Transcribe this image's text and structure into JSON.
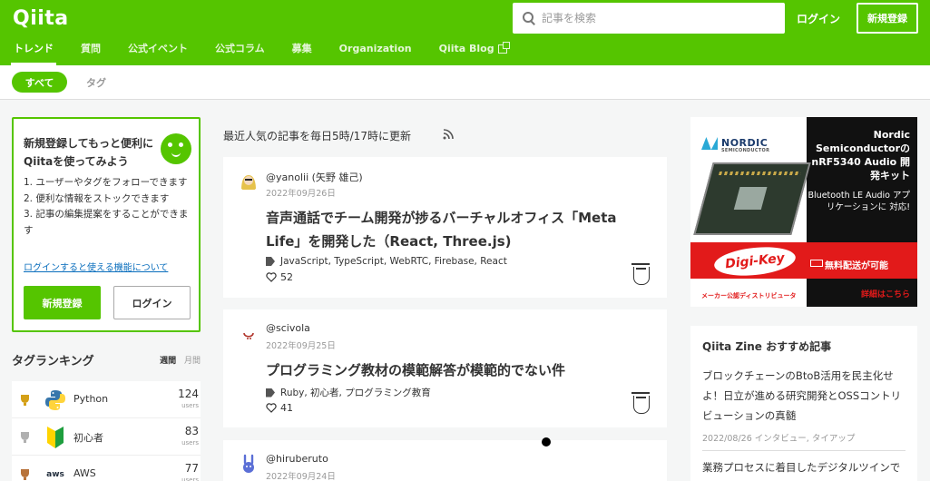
{
  "header": {
    "logo": "Qiita",
    "search_placeholder": "記事を検索",
    "login": "ログイン",
    "signup": "新規登録",
    "nav": [
      {
        "label": "トレンド",
        "active": true
      },
      {
        "label": "質問"
      },
      {
        "label": "公式イベント"
      },
      {
        "label": "公式コラム"
      },
      {
        "label": "募集"
      },
      {
        "label": "Organization"
      },
      {
        "label": "Qiita Blog",
        "external": true
      }
    ]
  },
  "subnav": {
    "all": "すべて",
    "tag": "タグ"
  },
  "signup_card": {
    "title": "新規登録してもっと便利にQiitaを使ってみよう",
    "items": [
      "1. ユーザーやタグをフォローできます",
      "2. 便利な情報をストックできます",
      "3. 記事の編集提案をすることができます"
    ],
    "features_link": "ログインすると使える機能について",
    "signup": "新規登録",
    "login": "ログイン"
  },
  "ranking": {
    "title": "タグランキング",
    "weekly": "週間",
    "monthly": "月間",
    "unit": "users",
    "rows": [
      {
        "name": "Python",
        "count": "124",
        "trophy_color": "#d4a017"
      },
      {
        "name": "初心者",
        "count": "83",
        "trophy_color": "#b0b0b0"
      },
      {
        "name": "AWS",
        "count": "77",
        "trophy_color": "#b8733a"
      }
    ]
  },
  "feed": {
    "update_note": "最近人気の記事を毎日5時/17時に更新",
    "articles": [
      {
        "author": "@yanolii (矢野 雄己)",
        "date": "2022年09月26日",
        "title": "音声通話でチーム開発が捗るバーチャルオフィス「Meta Life」を開発した（React, Three.js)",
        "tags": "JavaScript, TypeScript, WebRTC, Firebase, React",
        "likes": "52"
      },
      {
        "author": "@scivola",
        "date": "2022年09月25日",
        "title": "プログラミング教材の模範解答が模範的でない件",
        "tags": "Ruby, 初心者, プログラミング教育",
        "likes": "41"
      },
      {
        "author": "@hiruberuto",
        "date": "2022年09月24日"
      }
    ]
  },
  "ad": {
    "brand": "NORDIC",
    "brand_sub": "SEMICONDUCTOR",
    "headline": "Nordic Semiconductorの nRF5340 Audio 開発キット",
    "sub": "Bluetooth LE Audio アプリケーションに 対応!",
    "distributor": "Digi-Key",
    "distributor_sub": "ELECTRONICS",
    "free_shipping": "無料配送が可能",
    "maker_note": "メーカー公認ディストリビュータ",
    "detail": "詳細はこちら"
  },
  "zine": {
    "title": "Qiita Zine おすすめ記事",
    "article1": "ブロックチェーンのBtoB活用を民主化せよ！日立が進める研究開発とOSSコントリビューションの真髄",
    "meta1": "2022/08/26 インタビュー, タイアップ",
    "article2": "業務プロセスに着目したデジタルツインで"
  }
}
